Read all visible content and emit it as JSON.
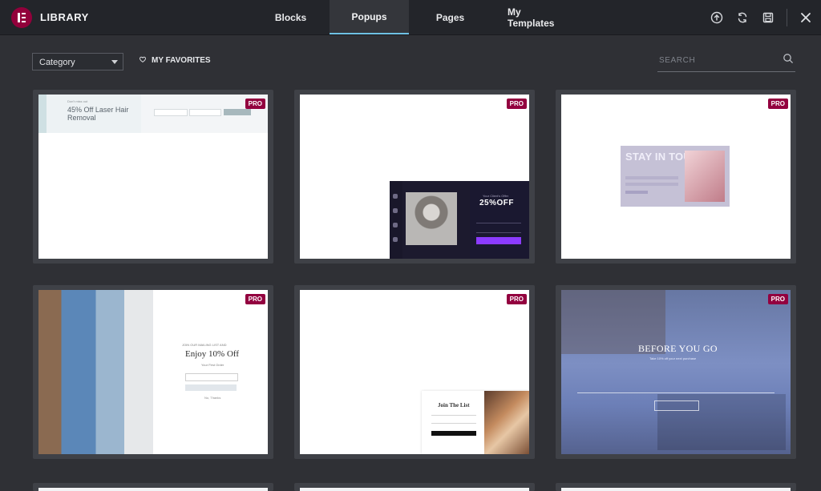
{
  "header": {
    "brand": "LIBRARY",
    "tabs": [
      {
        "label": "Blocks",
        "active": false
      },
      {
        "label": "Popups",
        "active": true
      },
      {
        "label": "Pages",
        "active": false
      },
      {
        "label": "My Templates",
        "active": false
      }
    ],
    "icons": [
      "upload-icon",
      "sync-icon",
      "save-icon",
      "close-icon"
    ]
  },
  "toolbar": {
    "category": {
      "value": "Category"
    },
    "favorites_label": "MY FAVORITES",
    "search": {
      "placeholder": "SEARCH",
      "value": ""
    }
  },
  "templates": [
    {
      "badge": "PRO",
      "content": {
        "small": "Don't miss out",
        "headline": "45% Off Laser Hair Removal"
      }
    },
    {
      "badge": "PRO",
      "content": {
        "small": "Your Client's Offer",
        "headline": "25%OFF"
      }
    },
    {
      "badge": "PRO",
      "content": {
        "headline": "STAY IN TOUCH"
      }
    },
    {
      "badge": "PRO",
      "content": {
        "small": "JOIN OUR MAILING LIST AND",
        "headline": "Enjoy 10% Off",
        "sub": "Your First Order",
        "tiny": "No, Thanks"
      }
    },
    {
      "badge": "PRO",
      "content": {
        "headline": "Join The List"
      }
    },
    {
      "badge": "PRO",
      "content": {
        "headline": "BEFORE YOU GO",
        "sub": "Take 10% off your next purchase"
      }
    }
  ],
  "colors": {
    "header_bg": "#23252a",
    "page_bg": "#2f3035",
    "accent": "#6ec1e4",
    "pro_badge": "#93003f"
  }
}
